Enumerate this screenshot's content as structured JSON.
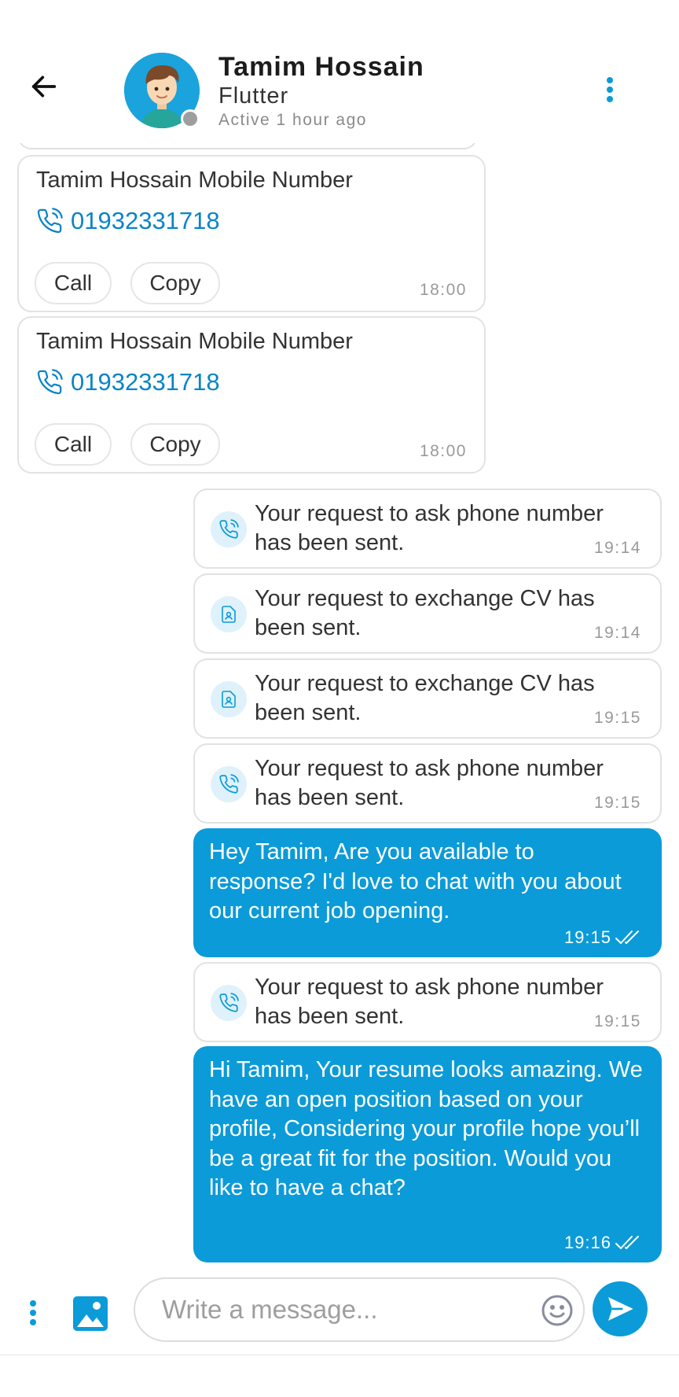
{
  "header": {
    "name": "Tamim Hossain",
    "subtitle": "Flutter",
    "status": "Active 1 hour ago",
    "back_icon": "arrow-left-icon",
    "menu_icon": "more-vertical-icon",
    "status_color": "#9e9e9e"
  },
  "contact_cards": [
    {
      "title": "Tamim Hossain Mobile Number",
      "phone": "01932331718",
      "call_label": "Call",
      "copy_label": "Copy",
      "time": "18:00"
    },
    {
      "title": "Tamim Hossain Mobile Number",
      "phone": "01932331718",
      "call_label": "Call",
      "copy_label": "Copy",
      "time": "18:00"
    }
  ],
  "notices": [
    {
      "icon": "phone-icon",
      "text": "Your request to ask phone number has been sent.",
      "time": "19:14"
    },
    {
      "icon": "document-icon",
      "text": "Your request to exchange CV has been sent.",
      "time": "19:14"
    },
    {
      "icon": "document-icon",
      "text": "Your request to exchange CV has been sent.",
      "time": "19:15"
    },
    {
      "icon": "phone-icon",
      "text": "Your request to ask phone number has been sent.",
      "time": "19:15"
    },
    {
      "icon": "phone-icon",
      "text": "Your request to ask phone number has been sent.",
      "time": "19:15"
    }
  ],
  "sent_messages": [
    {
      "text": "Hey Tamim, Are you available to response? I'd love to chat with you about our current job opening.",
      "time": "19:15",
      "status_icon": "double-check-icon"
    },
    {
      "text": "Hi Tamim, Your resume looks amazing. We have an open position based on your profile, Considering your profile hope you’ll be a great fit for the position. Would you like to have a chat?",
      "time": "19:16",
      "status_icon": "double-check-icon"
    }
  ],
  "composer": {
    "placeholder": "Write a message...",
    "value": ""
  },
  "colors": {
    "accent": "#0b9bd8",
    "link": "#0a84c6",
    "notice_icon_bg": "#dff1fb"
  }
}
